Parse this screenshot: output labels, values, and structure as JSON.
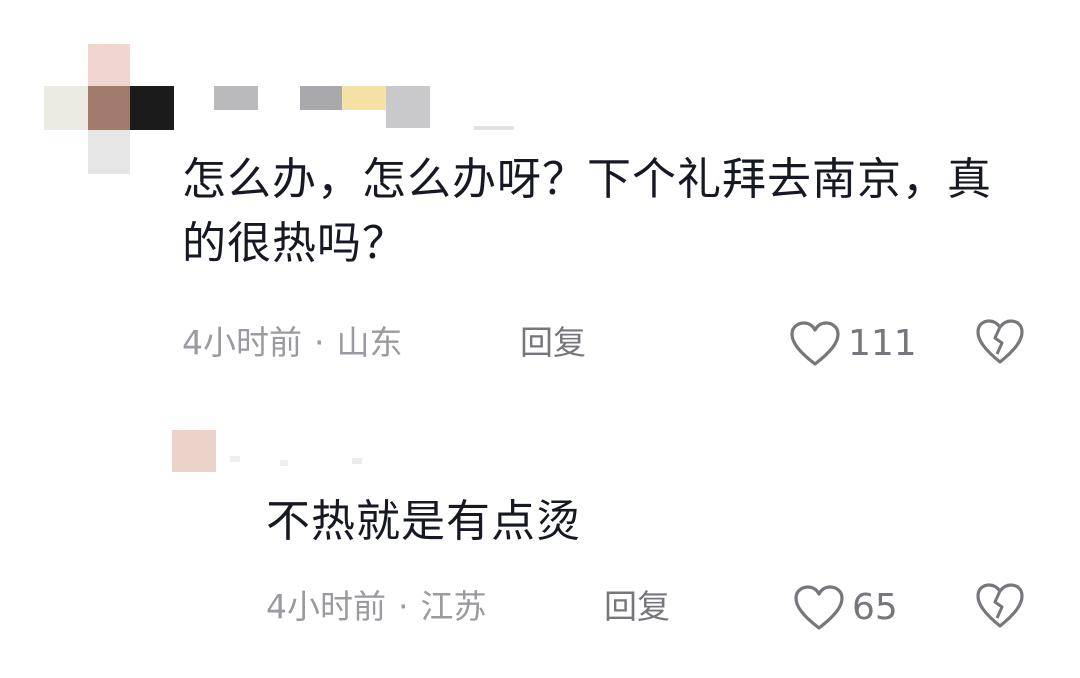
{
  "comments": [
    {
      "text": "怎么办，怎么办呀？下个礼拜去南京，真的很热吗？",
      "time": "4小时前",
      "location": "山东",
      "reply_label": "回复",
      "likes": "111"
    },
    {
      "text": "不热就是有点烫",
      "time": "4小时前",
      "location": "江苏",
      "reply_label": "回复",
      "likes": "65"
    }
  ],
  "icons": {
    "like": "heart-outline-icon",
    "dislike": "broken-heart-icon"
  },
  "colors": {
    "text": "#161823",
    "meta": "#9a9ba0",
    "action": "#76777c"
  }
}
